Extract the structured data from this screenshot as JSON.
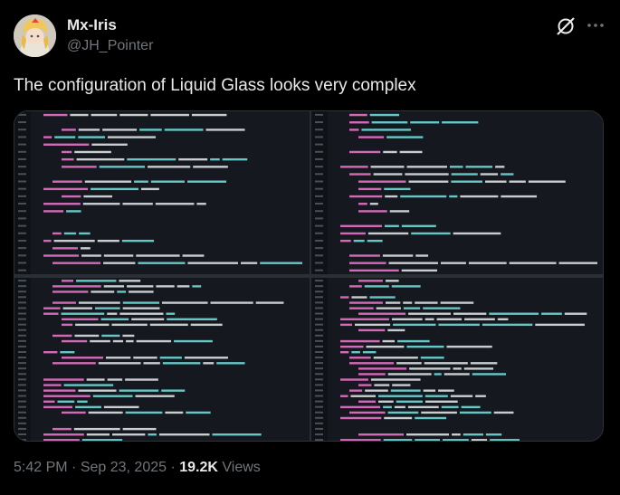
{
  "author": {
    "display_name": "Mx-Iris",
    "handle": "@JH_Pointer"
  },
  "header_icons": [
    "grok-icon",
    "more-icon"
  ],
  "tweet": {
    "text": "The configuration of Liquid Glass looks very complex"
  },
  "media": {
    "description_icon": "code-screenshot"
  },
  "meta": {
    "time": "5:42 PM",
    "sep1": " · ",
    "date": "Sep 23, 2025",
    "sep2": " · ",
    "views_count": "19.2K",
    "views_label": " Views"
  },
  "colors": {
    "background": "#000000",
    "text": "#e7e9ea",
    "secondary": "#71767b",
    "code_keyword": "#d36ab8",
    "code_type": "#66c7c7",
    "code_text": "#c8cdd2",
    "code_gutter": "#4a5058"
  }
}
